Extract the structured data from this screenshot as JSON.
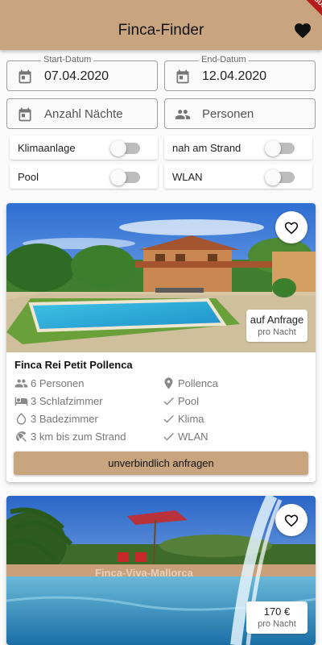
{
  "appbar": {
    "title": "Finca-Finder",
    "favorites_icon": "heart-filled-icon",
    "debug_ribbon": "DEBUG"
  },
  "filters": {
    "start_date": {
      "label": "Start-Datum",
      "value": "07.04.2020",
      "icon": "calendar-icon"
    },
    "end_date": {
      "label": "End-Datum",
      "value": "12.04.2020",
      "icon": "calendar-icon"
    },
    "nights": {
      "placeholder": "Anzahl Nächte",
      "icon": "calendar-icon"
    },
    "persons": {
      "placeholder": "Personen",
      "icon": "people-icon"
    },
    "toggles": [
      {
        "label": "Klimaanlage",
        "on": false
      },
      {
        "label": "nah am Strand",
        "on": false
      },
      {
        "label": "Pool",
        "on": false
      },
      {
        "label": "WLAN",
        "on": false
      }
    ]
  },
  "listings": [
    {
      "title": "Finca Rei Petit Pollenca",
      "price": "auf Anfrage",
      "price_unit": "pro Nacht",
      "favorite_icon": "heart-outline-icon",
      "features_left": [
        {
          "icon": "people-icon",
          "text": "6 Personen"
        },
        {
          "icon": "bed-icon",
          "text": "3 Schlafzimmer"
        },
        {
          "icon": "water-drop-icon",
          "text": "3 Badezimmer"
        },
        {
          "icon": "beach-umbrella-icon",
          "text": "3 km bis zum Strand"
        }
      ],
      "features_right": [
        {
          "icon": "location-pin-icon",
          "text": "Pollenca"
        },
        {
          "icon": "check-icon",
          "text": "Pool"
        },
        {
          "icon": "check-icon",
          "text": "Klima"
        },
        {
          "icon": "check-icon",
          "text": "WLAN"
        }
      ],
      "button_label": "unverbindlich anfragen"
    },
    {
      "price": "170 €",
      "price_unit": "pro Nacht",
      "favorite_icon": "heart-outline-icon",
      "photo_watermark": "Finca-Viva-Mallorca"
    }
  ],
  "colors": {
    "appbar": "#c9a57f",
    "button": "#c9a57f",
    "switch_track": "#bdbdbd"
  }
}
